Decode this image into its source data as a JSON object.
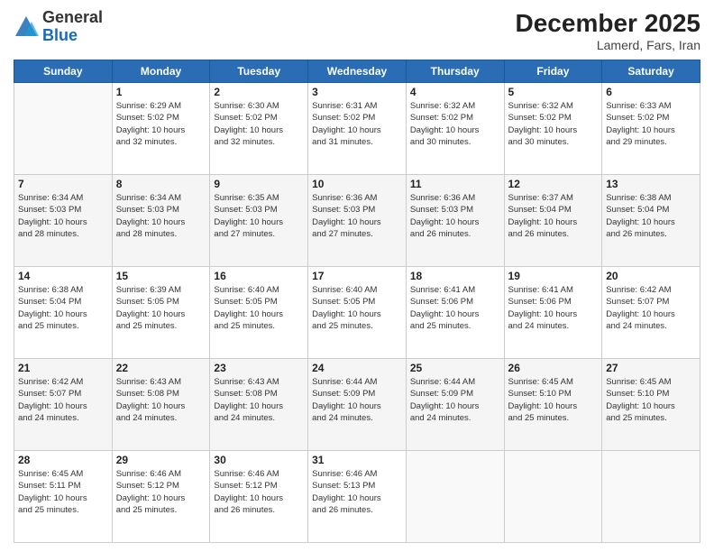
{
  "header": {
    "logo_general": "General",
    "logo_blue": "Blue",
    "month_title": "December 2025",
    "subtitle": "Lamerd, Fars, Iran"
  },
  "days_of_week": [
    "Sunday",
    "Monday",
    "Tuesday",
    "Wednesday",
    "Thursday",
    "Friday",
    "Saturday"
  ],
  "weeks": [
    [
      {
        "day": "",
        "info": ""
      },
      {
        "day": "1",
        "info": "Sunrise: 6:29 AM\nSunset: 5:02 PM\nDaylight: 10 hours\nand 32 minutes."
      },
      {
        "day": "2",
        "info": "Sunrise: 6:30 AM\nSunset: 5:02 PM\nDaylight: 10 hours\nand 32 minutes."
      },
      {
        "day": "3",
        "info": "Sunrise: 6:31 AM\nSunset: 5:02 PM\nDaylight: 10 hours\nand 31 minutes."
      },
      {
        "day": "4",
        "info": "Sunrise: 6:32 AM\nSunset: 5:02 PM\nDaylight: 10 hours\nand 30 minutes."
      },
      {
        "day": "5",
        "info": "Sunrise: 6:32 AM\nSunset: 5:02 PM\nDaylight: 10 hours\nand 30 minutes."
      },
      {
        "day": "6",
        "info": "Sunrise: 6:33 AM\nSunset: 5:02 PM\nDaylight: 10 hours\nand 29 minutes."
      }
    ],
    [
      {
        "day": "7",
        "info": "Sunrise: 6:34 AM\nSunset: 5:03 PM\nDaylight: 10 hours\nand 28 minutes."
      },
      {
        "day": "8",
        "info": "Sunrise: 6:34 AM\nSunset: 5:03 PM\nDaylight: 10 hours\nand 28 minutes."
      },
      {
        "day": "9",
        "info": "Sunrise: 6:35 AM\nSunset: 5:03 PM\nDaylight: 10 hours\nand 27 minutes."
      },
      {
        "day": "10",
        "info": "Sunrise: 6:36 AM\nSunset: 5:03 PM\nDaylight: 10 hours\nand 27 minutes."
      },
      {
        "day": "11",
        "info": "Sunrise: 6:36 AM\nSunset: 5:03 PM\nDaylight: 10 hours\nand 26 minutes."
      },
      {
        "day": "12",
        "info": "Sunrise: 6:37 AM\nSunset: 5:04 PM\nDaylight: 10 hours\nand 26 minutes."
      },
      {
        "day": "13",
        "info": "Sunrise: 6:38 AM\nSunset: 5:04 PM\nDaylight: 10 hours\nand 26 minutes."
      }
    ],
    [
      {
        "day": "14",
        "info": "Sunrise: 6:38 AM\nSunset: 5:04 PM\nDaylight: 10 hours\nand 25 minutes."
      },
      {
        "day": "15",
        "info": "Sunrise: 6:39 AM\nSunset: 5:05 PM\nDaylight: 10 hours\nand 25 minutes."
      },
      {
        "day": "16",
        "info": "Sunrise: 6:40 AM\nSunset: 5:05 PM\nDaylight: 10 hours\nand 25 minutes."
      },
      {
        "day": "17",
        "info": "Sunrise: 6:40 AM\nSunset: 5:05 PM\nDaylight: 10 hours\nand 25 minutes."
      },
      {
        "day": "18",
        "info": "Sunrise: 6:41 AM\nSunset: 5:06 PM\nDaylight: 10 hours\nand 25 minutes."
      },
      {
        "day": "19",
        "info": "Sunrise: 6:41 AM\nSunset: 5:06 PM\nDaylight: 10 hours\nand 24 minutes."
      },
      {
        "day": "20",
        "info": "Sunrise: 6:42 AM\nSunset: 5:07 PM\nDaylight: 10 hours\nand 24 minutes."
      }
    ],
    [
      {
        "day": "21",
        "info": "Sunrise: 6:42 AM\nSunset: 5:07 PM\nDaylight: 10 hours\nand 24 minutes."
      },
      {
        "day": "22",
        "info": "Sunrise: 6:43 AM\nSunset: 5:08 PM\nDaylight: 10 hours\nand 24 minutes."
      },
      {
        "day": "23",
        "info": "Sunrise: 6:43 AM\nSunset: 5:08 PM\nDaylight: 10 hours\nand 24 minutes."
      },
      {
        "day": "24",
        "info": "Sunrise: 6:44 AM\nSunset: 5:09 PM\nDaylight: 10 hours\nand 24 minutes."
      },
      {
        "day": "25",
        "info": "Sunrise: 6:44 AM\nSunset: 5:09 PM\nDaylight: 10 hours\nand 24 minutes."
      },
      {
        "day": "26",
        "info": "Sunrise: 6:45 AM\nSunset: 5:10 PM\nDaylight: 10 hours\nand 25 minutes."
      },
      {
        "day": "27",
        "info": "Sunrise: 6:45 AM\nSunset: 5:10 PM\nDaylight: 10 hours\nand 25 minutes."
      }
    ],
    [
      {
        "day": "28",
        "info": "Sunrise: 6:45 AM\nSunset: 5:11 PM\nDaylight: 10 hours\nand 25 minutes."
      },
      {
        "day": "29",
        "info": "Sunrise: 6:46 AM\nSunset: 5:12 PM\nDaylight: 10 hours\nand 25 minutes."
      },
      {
        "day": "30",
        "info": "Sunrise: 6:46 AM\nSunset: 5:12 PM\nDaylight: 10 hours\nand 26 minutes."
      },
      {
        "day": "31",
        "info": "Sunrise: 6:46 AM\nSunset: 5:13 PM\nDaylight: 10 hours\nand 26 minutes."
      },
      {
        "day": "",
        "info": ""
      },
      {
        "day": "",
        "info": ""
      },
      {
        "day": "",
        "info": ""
      }
    ]
  ]
}
